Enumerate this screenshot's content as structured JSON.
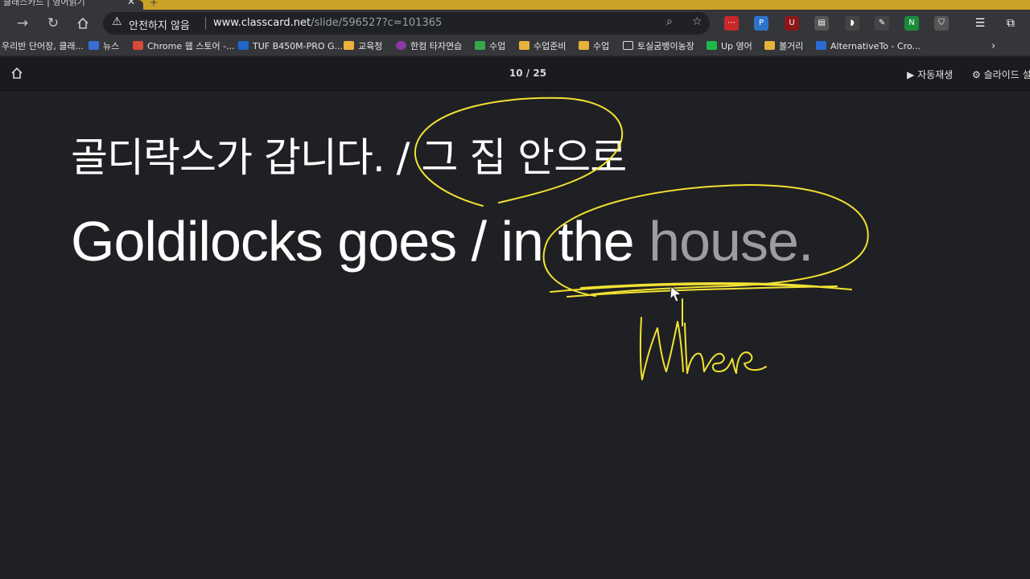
{
  "browser": {
    "warning_text": "안전하지 않음",
    "url_host": "www.classcard.net",
    "url_path": "/slide/596527?c=101365"
  },
  "bookmarks": [
    {
      "label": "우리반 단어장, 클래...",
      "icon": "none"
    },
    {
      "label": "뉴스",
      "icon": "news-icon"
    },
    {
      "label": "Chrome 웹 스토어 -...",
      "icon": "webstore-icon"
    },
    {
      "label": "TUF B450M-PRO G...",
      "icon": "asus-icon"
    },
    {
      "label": "교육청",
      "icon": "folder-icon"
    },
    {
      "label": "한컴 타자연습",
      "icon": "hancom-icon"
    },
    {
      "label": "수업",
      "icon": "image-icon"
    },
    {
      "label": "수업준비",
      "icon": "folder-icon"
    },
    {
      "label": "수업",
      "icon": "folder-icon"
    },
    {
      "label": "토실굼뱅이농장",
      "icon": "page-icon"
    },
    {
      "label": "Up 영어",
      "icon": "naver-icon"
    },
    {
      "label": "볼거리",
      "icon": "folder-icon"
    },
    {
      "label": "AlternativeTo - Cro...",
      "icon": "alternativeto-icon"
    }
  ],
  "header": {
    "counter": "10 / 25",
    "autoplay_label": "자동재생",
    "settings_label": "슬라이드 설"
  },
  "slide": {
    "korean": "골디락스가 갑니다. / 그 집 안으로",
    "english_main": "Goldilocks goes / in the ",
    "english_dim": "house.",
    "annotation_text": "Where"
  },
  "colors": {
    "annotation": "#f2e233",
    "background": "#1f2023"
  }
}
